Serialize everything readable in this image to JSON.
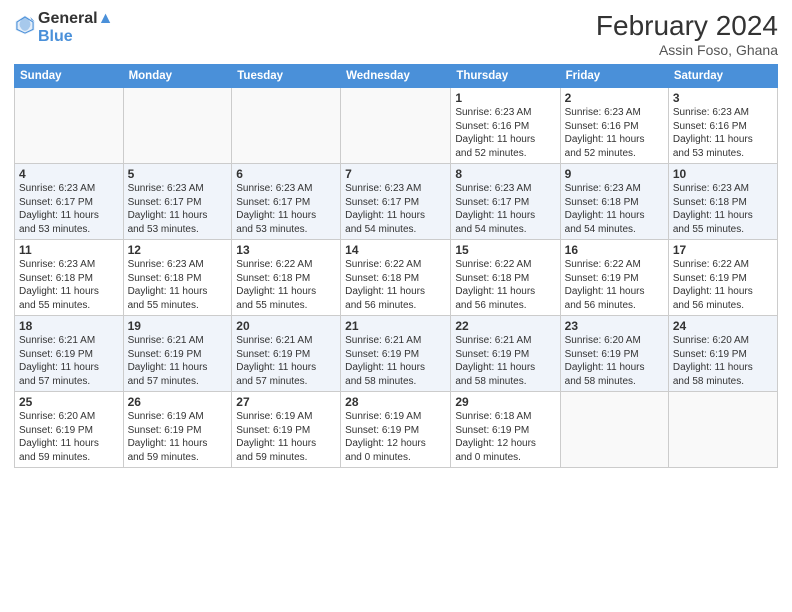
{
  "header": {
    "logo_line1": "General",
    "logo_line2": "Blue",
    "month_year": "February 2024",
    "location": "Assin Foso, Ghana"
  },
  "weekdays": [
    "Sunday",
    "Monday",
    "Tuesday",
    "Wednesday",
    "Thursday",
    "Friday",
    "Saturday"
  ],
  "weeks": [
    [
      {
        "day": "",
        "info": ""
      },
      {
        "day": "",
        "info": ""
      },
      {
        "day": "",
        "info": ""
      },
      {
        "day": "",
        "info": ""
      },
      {
        "day": "1",
        "info": "Sunrise: 6:23 AM\nSunset: 6:16 PM\nDaylight: 11 hours\nand 52 minutes."
      },
      {
        "day": "2",
        "info": "Sunrise: 6:23 AM\nSunset: 6:16 PM\nDaylight: 11 hours\nand 52 minutes."
      },
      {
        "day": "3",
        "info": "Sunrise: 6:23 AM\nSunset: 6:16 PM\nDaylight: 11 hours\nand 53 minutes."
      }
    ],
    [
      {
        "day": "4",
        "info": "Sunrise: 6:23 AM\nSunset: 6:17 PM\nDaylight: 11 hours\nand 53 minutes."
      },
      {
        "day": "5",
        "info": "Sunrise: 6:23 AM\nSunset: 6:17 PM\nDaylight: 11 hours\nand 53 minutes."
      },
      {
        "day": "6",
        "info": "Sunrise: 6:23 AM\nSunset: 6:17 PM\nDaylight: 11 hours\nand 53 minutes."
      },
      {
        "day": "7",
        "info": "Sunrise: 6:23 AM\nSunset: 6:17 PM\nDaylight: 11 hours\nand 54 minutes."
      },
      {
        "day": "8",
        "info": "Sunrise: 6:23 AM\nSunset: 6:17 PM\nDaylight: 11 hours\nand 54 minutes."
      },
      {
        "day": "9",
        "info": "Sunrise: 6:23 AM\nSunset: 6:18 PM\nDaylight: 11 hours\nand 54 minutes."
      },
      {
        "day": "10",
        "info": "Sunrise: 6:23 AM\nSunset: 6:18 PM\nDaylight: 11 hours\nand 55 minutes."
      }
    ],
    [
      {
        "day": "11",
        "info": "Sunrise: 6:23 AM\nSunset: 6:18 PM\nDaylight: 11 hours\nand 55 minutes."
      },
      {
        "day": "12",
        "info": "Sunrise: 6:23 AM\nSunset: 6:18 PM\nDaylight: 11 hours\nand 55 minutes."
      },
      {
        "day": "13",
        "info": "Sunrise: 6:22 AM\nSunset: 6:18 PM\nDaylight: 11 hours\nand 55 minutes."
      },
      {
        "day": "14",
        "info": "Sunrise: 6:22 AM\nSunset: 6:18 PM\nDaylight: 11 hours\nand 56 minutes."
      },
      {
        "day": "15",
        "info": "Sunrise: 6:22 AM\nSunset: 6:18 PM\nDaylight: 11 hours\nand 56 minutes."
      },
      {
        "day": "16",
        "info": "Sunrise: 6:22 AM\nSunset: 6:19 PM\nDaylight: 11 hours\nand 56 minutes."
      },
      {
        "day": "17",
        "info": "Sunrise: 6:22 AM\nSunset: 6:19 PM\nDaylight: 11 hours\nand 56 minutes."
      }
    ],
    [
      {
        "day": "18",
        "info": "Sunrise: 6:21 AM\nSunset: 6:19 PM\nDaylight: 11 hours\nand 57 minutes."
      },
      {
        "day": "19",
        "info": "Sunrise: 6:21 AM\nSunset: 6:19 PM\nDaylight: 11 hours\nand 57 minutes."
      },
      {
        "day": "20",
        "info": "Sunrise: 6:21 AM\nSunset: 6:19 PM\nDaylight: 11 hours\nand 57 minutes."
      },
      {
        "day": "21",
        "info": "Sunrise: 6:21 AM\nSunset: 6:19 PM\nDaylight: 11 hours\nand 58 minutes."
      },
      {
        "day": "22",
        "info": "Sunrise: 6:21 AM\nSunset: 6:19 PM\nDaylight: 11 hours\nand 58 minutes."
      },
      {
        "day": "23",
        "info": "Sunrise: 6:20 AM\nSunset: 6:19 PM\nDaylight: 11 hours\nand 58 minutes."
      },
      {
        "day": "24",
        "info": "Sunrise: 6:20 AM\nSunset: 6:19 PM\nDaylight: 11 hours\nand 58 minutes."
      }
    ],
    [
      {
        "day": "25",
        "info": "Sunrise: 6:20 AM\nSunset: 6:19 PM\nDaylight: 11 hours\nand 59 minutes."
      },
      {
        "day": "26",
        "info": "Sunrise: 6:19 AM\nSunset: 6:19 PM\nDaylight: 11 hours\nand 59 minutes."
      },
      {
        "day": "27",
        "info": "Sunrise: 6:19 AM\nSunset: 6:19 PM\nDaylight: 11 hours\nand 59 minutes."
      },
      {
        "day": "28",
        "info": "Sunrise: 6:19 AM\nSunset: 6:19 PM\nDaylight: 12 hours\nand 0 minutes."
      },
      {
        "day": "29",
        "info": "Sunrise: 6:18 AM\nSunset: 6:19 PM\nDaylight: 12 hours\nand 0 minutes."
      },
      {
        "day": "",
        "info": ""
      },
      {
        "day": "",
        "info": ""
      }
    ]
  ]
}
